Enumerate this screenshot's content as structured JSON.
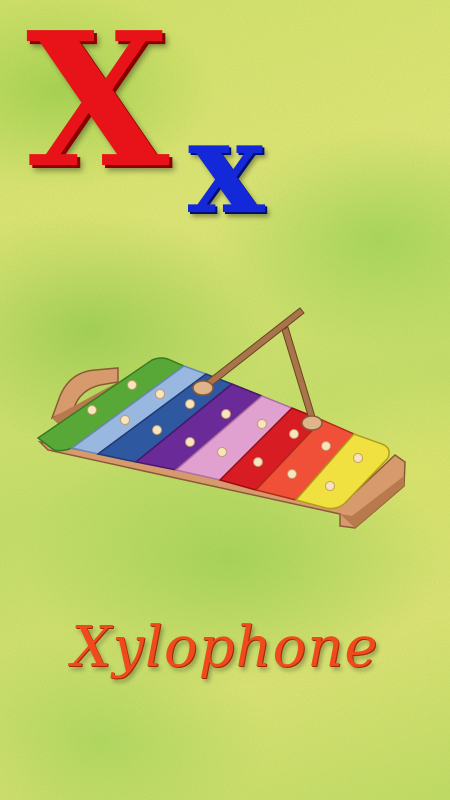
{
  "card": {
    "uppercase_letter": "X",
    "lowercase_letter": "x",
    "word": "Xylophone",
    "illustration_icon": "xylophone-icon"
  },
  "colors": {
    "uppercase_letter": "#e81318",
    "lowercase_letter": "#1328d8",
    "word": "#f04a1c",
    "frame": "#d69a6c",
    "mallet": "#a8744a",
    "bars": [
      "#58a838",
      "#98b8e0",
      "#2e58a0",
      "#6a2a98",
      "#e0a0d0",
      "#d81c24",
      "#f05038",
      "#f0e040"
    ]
  }
}
